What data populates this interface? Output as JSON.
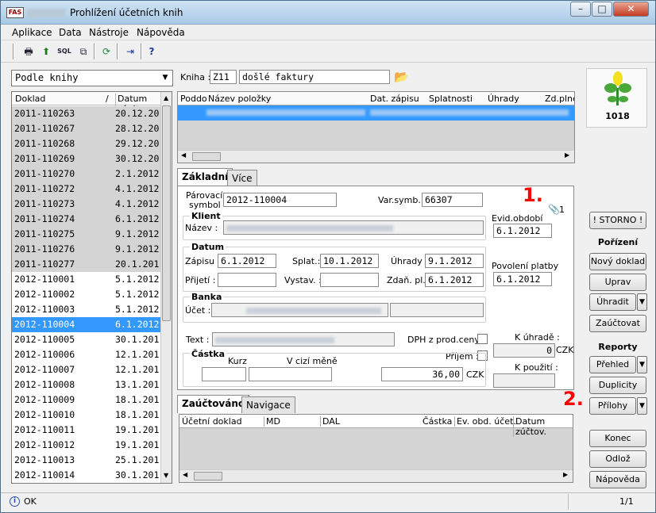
{
  "window": {
    "title": "Prohlížení účetních knih",
    "minimize": "–",
    "maximize": "□",
    "close": "✕",
    "app_icon_text": "FAS"
  },
  "menu": [
    "Aplikace",
    "Data",
    "Nástroje",
    "Nápověda"
  ],
  "left": {
    "combo": "Podle knihy",
    "col_doklad": "Doklad",
    "col_sort": "/",
    "col_datum": "Datum zápi",
    "rows": [
      {
        "d": "2011-110263",
        "dt": "20.12.20"
      },
      {
        "d": "2011-110267",
        "dt": "28.12.20"
      },
      {
        "d": "2011-110268",
        "dt": "29.12.20"
      },
      {
        "d": "2011-110269",
        "dt": "30.12.20"
      },
      {
        "d": "2011-110270",
        "dt": "2.1.2012"
      },
      {
        "d": "2011-110272",
        "dt": "4.1.2012"
      },
      {
        "d": "2011-110273",
        "dt": "4.1.2012"
      },
      {
        "d": "2011-110274",
        "dt": "6.1.2012"
      },
      {
        "d": "2011-110275",
        "dt": "9.1.2012"
      },
      {
        "d": "2011-110276",
        "dt": "9.1.2012"
      },
      {
        "d": "2011-110277",
        "dt": "20.1.201"
      },
      {
        "d": "2012-110001",
        "dt": "5.1.2012"
      },
      {
        "d": "2012-110002",
        "dt": "5.1.2012"
      },
      {
        "d": "2012-110003",
        "dt": "5.1.2012"
      },
      {
        "d": "2012-110004",
        "dt": "6.1.2012"
      },
      {
        "d": "2012-110005",
        "dt": "30.1.201"
      },
      {
        "d": "2012-110006",
        "dt": "12.1.201"
      },
      {
        "d": "2012-110007",
        "dt": "12.1.201"
      },
      {
        "d": "2012-110008",
        "dt": "13.1.201"
      },
      {
        "d": "2012-110009",
        "dt": "18.1.201"
      },
      {
        "d": "2012-110010",
        "dt": "18.1.201"
      },
      {
        "d": "2012-110011",
        "dt": "19.1.201"
      },
      {
        "d": "2012-110012",
        "dt": "19.1.201"
      },
      {
        "d": "2012-110013",
        "dt": "25.1.201"
      },
      {
        "d": "2012-110014",
        "dt": "30.1.201"
      }
    ]
  },
  "kniha": {
    "label": "Kniha :",
    "code": "Z11",
    "name": "došlé faktury"
  },
  "items_grid": {
    "cols": [
      "Poddo",
      "Název položky",
      "Dat. zápisu",
      "Splatnosti",
      "Úhrady",
      "Zd.plně"
    ]
  },
  "tabs_top": [
    "Základní",
    "Více"
  ],
  "form": {
    "parovaci_label1": "Párovací",
    "parovaci_label2": "symbol",
    "parovaci": "2012-110004",
    "varsymb_label": "Var.symb.:",
    "varsymb": "66307",
    "attach_count": "1",
    "klient_title": "Klient",
    "nazev_label": "Název :",
    "evid_label": "Evid.období",
    "evid": "6.1.2012",
    "datum_title": "Datum",
    "zapisu_label": "Zápisu :",
    "zapisu": "6.1.2012",
    "splat_label": "Splat.:",
    "splat": "10.1.2012",
    "uhrady_label": "Úhrady :",
    "uhrady": "9.1.2012",
    "povoleni_label": "Povolení platby",
    "povoleni": "6.1.2012",
    "prijeti_label": "Přijetí :",
    "vystav_label": "Vystav. :",
    "zdan_label": "Zdaň. pl.:",
    "zdan": "6.1.2012",
    "banka_title": "Banka",
    "ucet_label": "Účet :",
    "text_label": "Text :",
    "dph_label": "DPH z prod.ceny :",
    "prijem_label": "Příjem :",
    "kuhrade_label": "K úhradě :",
    "kuhrade": "0",
    "kuhrade_cur": "CZK",
    "castka_title": "Částka",
    "kurz_label": "Kurz",
    "cizi_label": "V cizí měně",
    "castka": "36,00",
    "castka_cur": "CZK",
    "kpouziti_label": "K použití :"
  },
  "tabs_bottom": [
    "Zaúčtováno",
    "Navigace"
  ],
  "posting_grid": {
    "cols": [
      "Účetní doklad",
      "MD",
      "DAL",
      "Částka",
      "Ev. obd. účet.",
      "Datum zúčtov."
    ]
  },
  "annotations": {
    "one": "1.",
    "two": "2."
  },
  "right": {
    "number": "1018",
    "storno": "! STORNO !",
    "porizeni": "Pořízení",
    "novy": "Nový doklad",
    "uprav": "Uprav",
    "uhradit": "Úhradit",
    "zauctovat": "Zaúčtovat",
    "reporty": "Reporty",
    "prehled": "Přehled",
    "duplicity": "Duplicity",
    "prilohy": "Přílohy",
    "konec": "Konec",
    "odloz": "Odlož",
    "napoveda": "Nápověda"
  },
  "status": {
    "text": "OK",
    "page": "1/1"
  }
}
